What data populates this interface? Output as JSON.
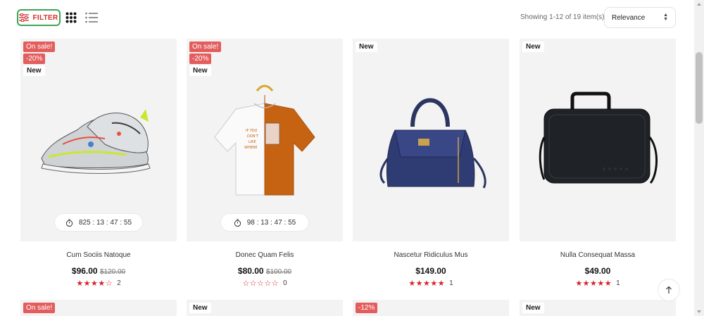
{
  "toolbar": {
    "filter_label": "FILTER",
    "filter_icon": "sliders-icon",
    "grid_icon": "grid-dots-icon",
    "list_icon": "list-icon",
    "showing_text": "Showing 1-12 of 19 item(s)",
    "sort_selected": "Relevance"
  },
  "colors": {
    "accent_red": "#d12d2d",
    "sale_badge": "#e35d5d",
    "star": "#d8232a",
    "filter_border": "#3aa655"
  },
  "products": [
    {
      "badges": [
        "On sale!",
        "-20%"
      ],
      "new": "New",
      "countdown": "825 : 13 : 47 : 55",
      "name": "Cum Sociis Natoque",
      "price": "$96.00",
      "old_price": "$120.00",
      "stars": "★★★★☆",
      "review_count": "2"
    },
    {
      "badges": [
        "On sale!",
        "-20%"
      ],
      "new": "New",
      "countdown": "98 : 13 : 47 : 55",
      "name": "Donec Quam Felis",
      "price": "$80.00",
      "old_price": "$100.00",
      "stars": "☆☆☆☆☆",
      "review_count": "0"
    },
    {
      "new": "New",
      "name": "Nascetur Ridiculus Mus",
      "price": "$149.00",
      "stars": "★★★★★",
      "review_count": "1"
    },
    {
      "new": "New",
      "name": "Nulla Consequat Massa",
      "price": "$49.00",
      "stars": "★★★★★",
      "review_count": "1"
    }
  ],
  "next_row": [
    {
      "badge": "On sale!"
    },
    {
      "badge": "New"
    },
    {
      "badge": "-12%"
    },
    {
      "badge": "New"
    }
  ],
  "back_to_top_icon": "arrow-up-icon"
}
